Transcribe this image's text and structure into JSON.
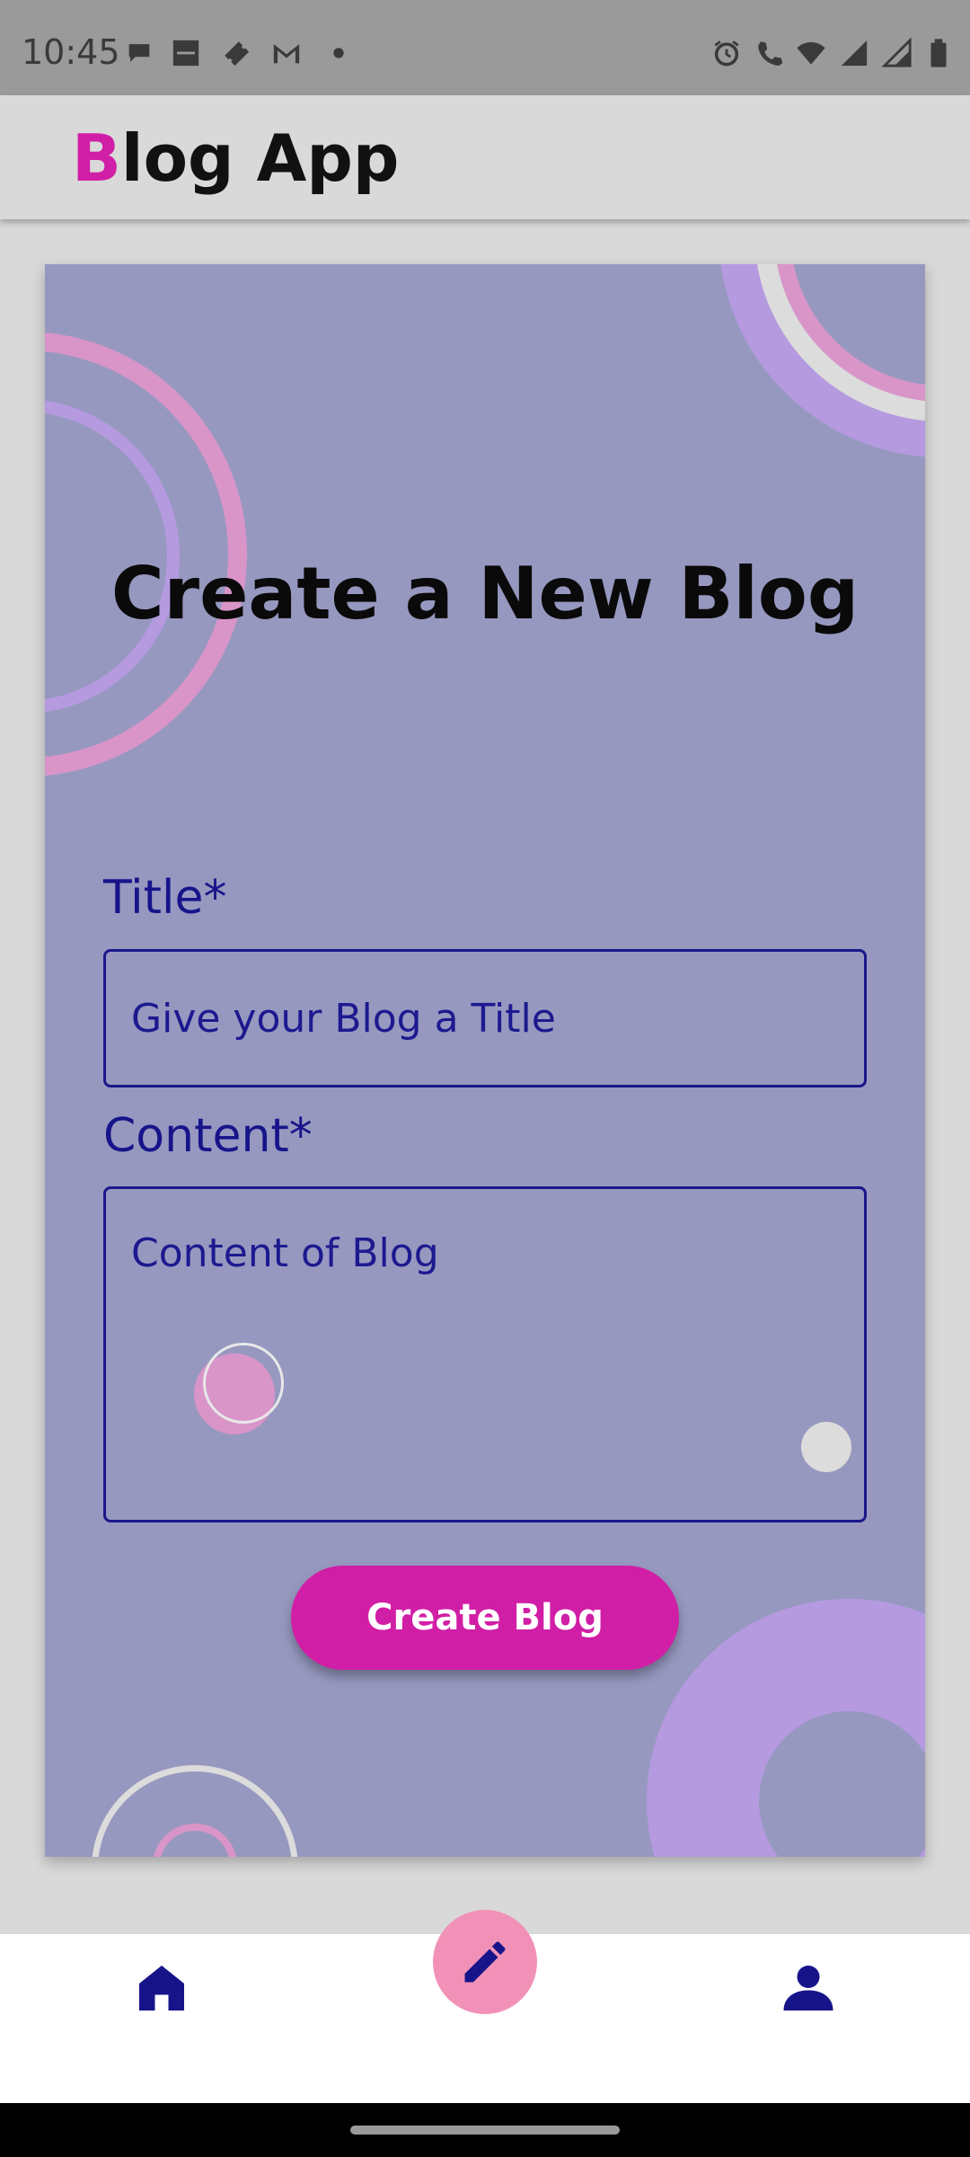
{
  "status_bar": {
    "time": "10:45",
    "icons_left": [
      "chat-icon",
      "zomato-icon",
      "ticket-icon",
      "gmail-icon",
      "dot-icon"
    ],
    "icons_right": [
      "alarm-icon",
      "call-icon",
      "wifi-icon",
      "signal-icon",
      "signal-2-icon",
      "battery-icon"
    ]
  },
  "app_bar": {
    "brand_first": "B",
    "brand_rest": "log App"
  },
  "form": {
    "heading": "Create a New Blog",
    "title_label": "Title*",
    "title_placeholder": "Give your Blog a Title",
    "content_label": "Content*",
    "content_placeholder": "Content of Blog",
    "submit_label": "Create Blog"
  },
  "bottom_nav": {
    "items": [
      "home-icon",
      "pencil-icon",
      "profile-icon"
    ]
  },
  "colors": {
    "accent": "#d11ea6",
    "primary": "#17148a",
    "card_bg": "#9798c0",
    "fab": "#f291b7"
  }
}
